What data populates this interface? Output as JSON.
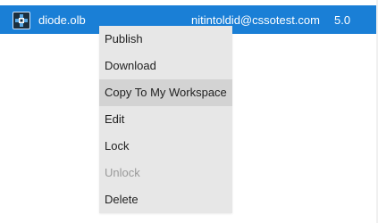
{
  "row": {
    "file_name": "diode.olb",
    "owner": "nitintoldid@cssotest.com",
    "version": "5.0",
    "icon": "component-file-icon",
    "selected_color": "#1a7fd6"
  },
  "context_menu": {
    "items": [
      {
        "label": "Publish",
        "state": "enabled"
      },
      {
        "label": "Download",
        "state": "enabled"
      },
      {
        "label": "Copy To My Workspace",
        "state": "hovered"
      },
      {
        "label": "Edit",
        "state": "enabled"
      },
      {
        "label": "Lock",
        "state": "enabled"
      },
      {
        "label": "Unlock",
        "state": "disabled"
      },
      {
        "label": "Delete",
        "state": "enabled"
      }
    ]
  }
}
